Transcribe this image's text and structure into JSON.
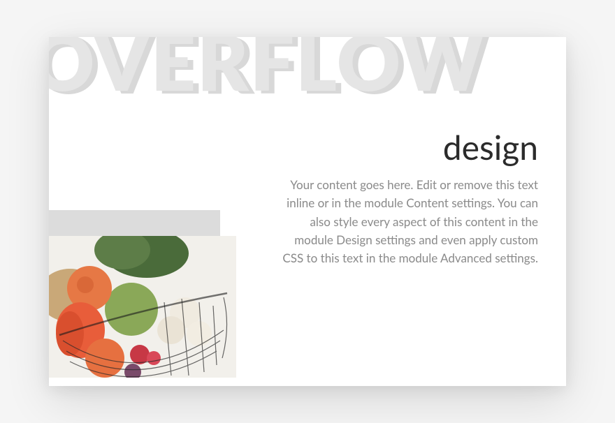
{
  "bigText": "OVERFLOW",
  "content": {
    "heading": "design",
    "body": "Your content goes here. Edit or remove this text inline or in the module Content settings. You can also style every aspect of this content in the module Design settings and even apply custom CSS to this text in the module Advanced settings."
  }
}
